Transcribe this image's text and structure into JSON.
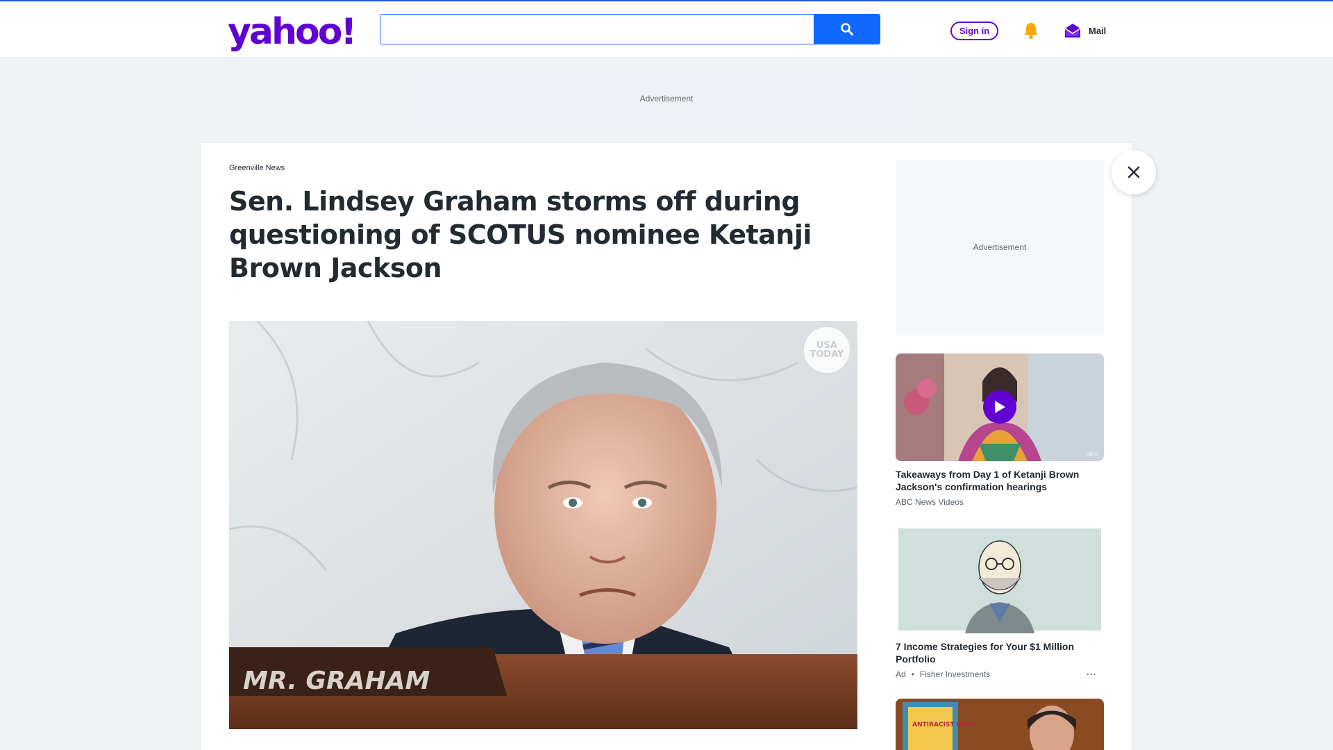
{
  "header": {
    "logo_text": "yahoo!",
    "search_placeholder": "",
    "sign_in_label": "Sign in",
    "mail_label": "Mail"
  },
  "ads": {
    "top_label": "Advertisement",
    "side_label": "Advertisement"
  },
  "article": {
    "source": "Greenville News",
    "headline": "Sen. Lindsey Graham storms off during questioning of SCOTUS nominee Ketanji Brown Jackson",
    "image_badge": "USA TODAY",
    "nameplate": "MR. GRAHAM"
  },
  "sidebar": {
    "items": [
      {
        "title": "Takeaways from Day 1 of Ketanji Brown Jackson's confirmation hearings",
        "source": "ABC News Videos",
        "watermark": "abc",
        "is_video": true
      },
      {
        "title": "7 Income Strategies for Your $1 Million Portfolio",
        "ad_label": "Ad",
        "source": "Fisher Investments",
        "more": "···"
      }
    ],
    "third_item_text": "ANTIRACIST BABY"
  },
  "colors": {
    "brand": "#6001d2",
    "search_accent": "#0f69ff",
    "bell": "#ffa700"
  }
}
